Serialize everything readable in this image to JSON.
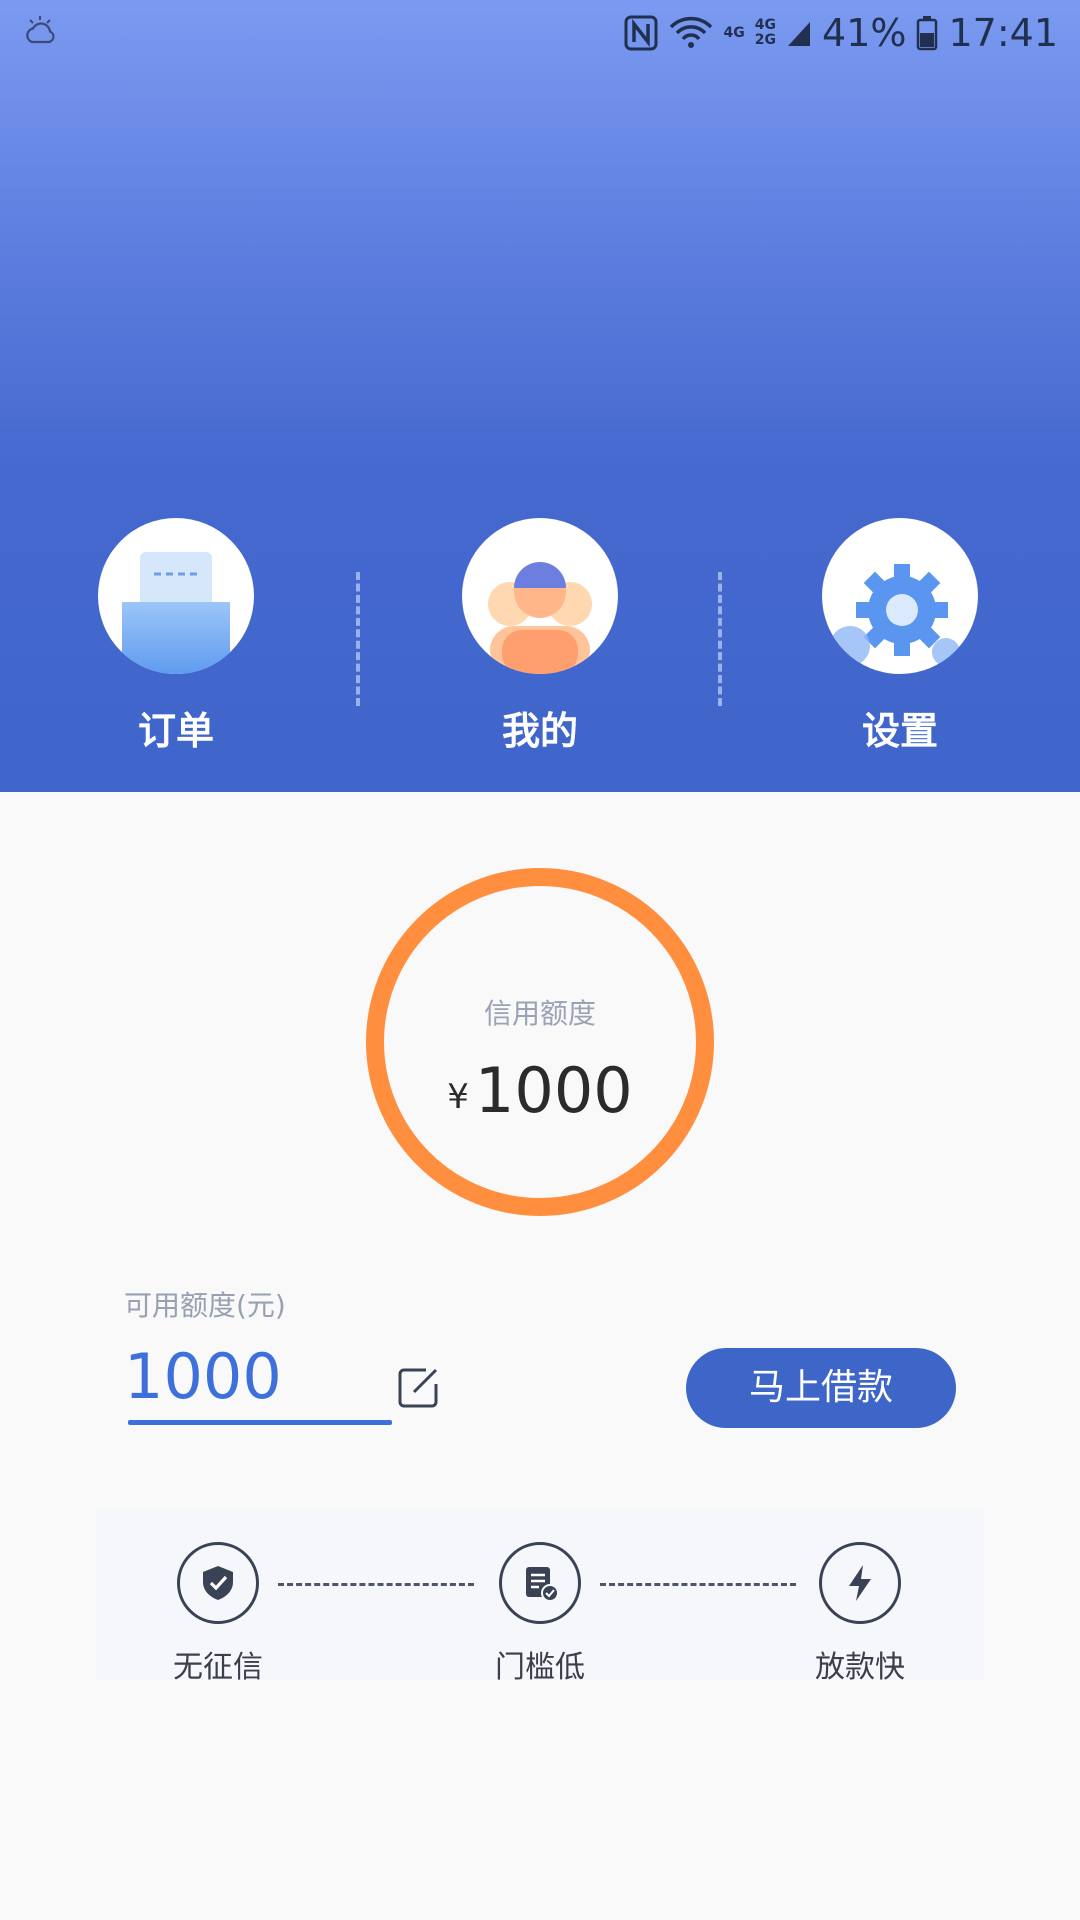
{
  "status_bar": {
    "weather_icon": "cloud-icon",
    "net_top": "4G",
    "net_dual_top": "4G",
    "net_dual_bottom": "2G",
    "battery": "41%",
    "time": "17:41"
  },
  "nav": {
    "items": [
      {
        "label": "订单",
        "icon": "order-icon"
      },
      {
        "label": "我的",
        "icon": "profile-icon"
      },
      {
        "label": "设置",
        "icon": "settings-gear-icon"
      }
    ]
  },
  "credit": {
    "label": "信用额度",
    "currency": "¥",
    "amount": "1000",
    "ring_color": "#ff8f3f"
  },
  "available": {
    "label": "可用额度(元)",
    "value": "1000",
    "edit_icon": "edit-icon"
  },
  "borrow_button": {
    "label": "马上借款"
  },
  "features": [
    {
      "label": "无征信",
      "icon": "shield-check-icon"
    },
    {
      "label": "门槛低",
      "icon": "document-check-icon"
    },
    {
      "label": "放款快",
      "icon": "lightning-icon"
    }
  ],
  "colors": {
    "header_top": "#7b9af1",
    "header_bottom": "#3f66cb",
    "accent": "#3e70db",
    "button": "#3e66c8"
  }
}
